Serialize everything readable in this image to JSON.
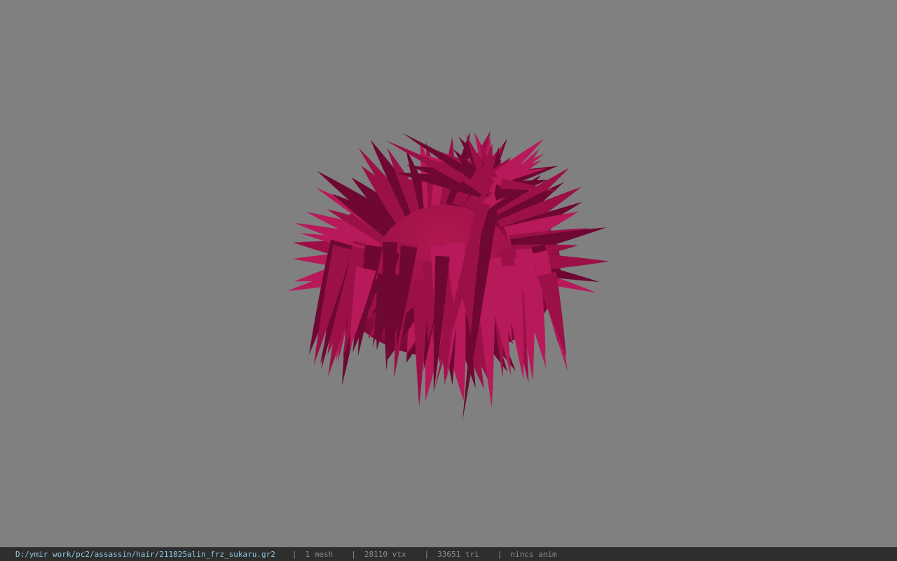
{
  "viewport": {
    "background_color": "#808080",
    "model_color": "#9c1048",
    "model_highlight": "#b8195a",
    "model_shadow": "#6e0832",
    "model_subject": "hair-mesh"
  },
  "statusbar": {
    "file_path": "D:/ymir work/pc2/assassin/hair/211025alin_frz_sukaru.gr2",
    "separator": "|",
    "mesh_count": "1 mesh",
    "vertex_count": "28110 vtx",
    "triangle_count": "33651 tri",
    "anim_status": "nincs anim"
  }
}
